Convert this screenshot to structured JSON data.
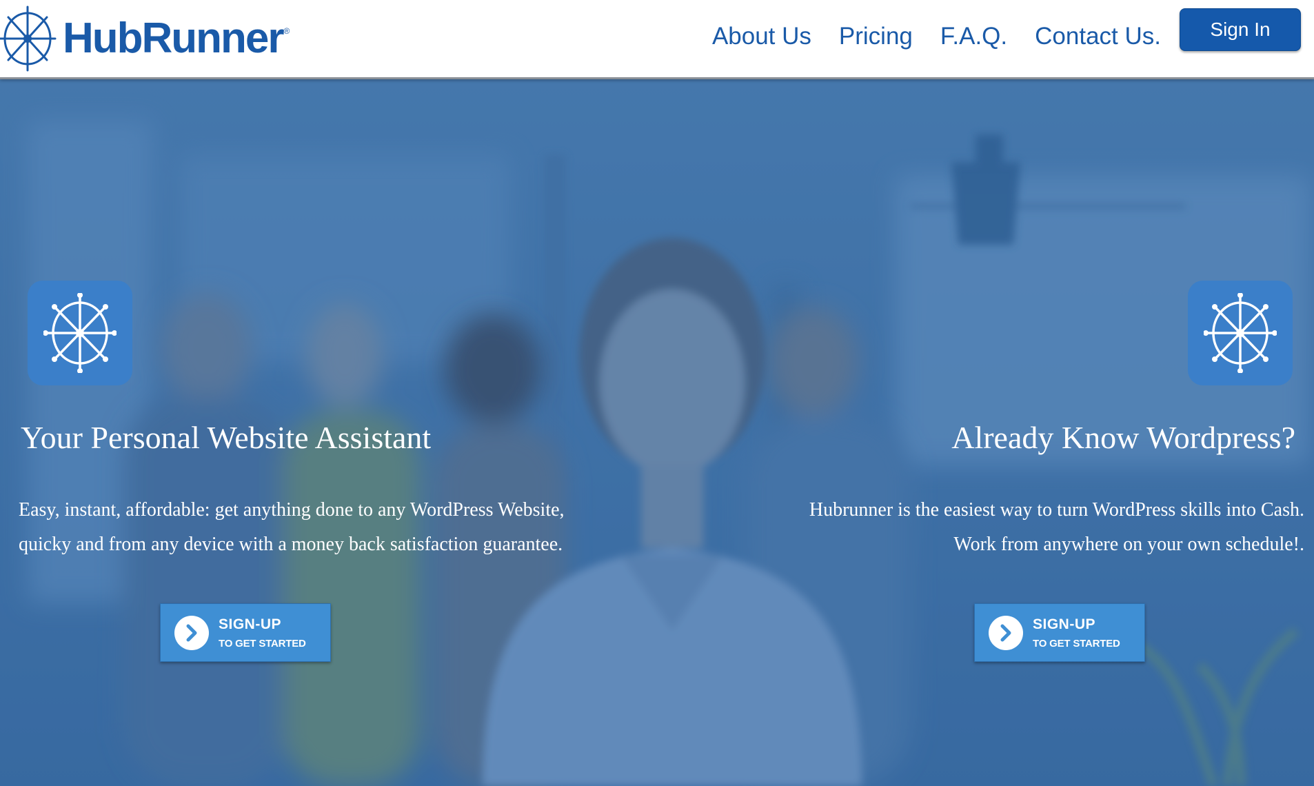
{
  "brand": {
    "name": "HubRunner",
    "registered_mark": "®",
    "color": "#1a5aa8"
  },
  "nav": {
    "links": [
      "About Us",
      "Pricing",
      "F.A.Q.",
      "Contact Us."
    ],
    "sign_in": "Sign In"
  },
  "colors": {
    "nav_text": "#1a5aa8",
    "sign_in_bg": "#1559ab",
    "hero_tint": "#3f6d9f",
    "icon_tile": "#3b7fc9",
    "signup_bg": "#3f8fd4"
  },
  "features": [
    {
      "icon": "ship-wheel-icon",
      "title": "Your Personal Website Assistant",
      "lines": [
        "Easy, instant, affordable: get anything done to any WordPress Website,",
        "quicky and from any device with a money back satisfaction guarantee."
      ],
      "cta_main": "SIGN-UP",
      "cta_sub": "TO GET STARTED"
    },
    {
      "icon": "ship-wheel-icon",
      "title": "Already Know Wordpress?",
      "lines": [
        "Hubrunner is the easiest way to turn WordPress skills into Cash.",
        "Work from anywhere on your own schedule!."
      ],
      "cta_main": "SIGN-UP",
      "cta_sub": "TO GET STARTED"
    }
  ]
}
